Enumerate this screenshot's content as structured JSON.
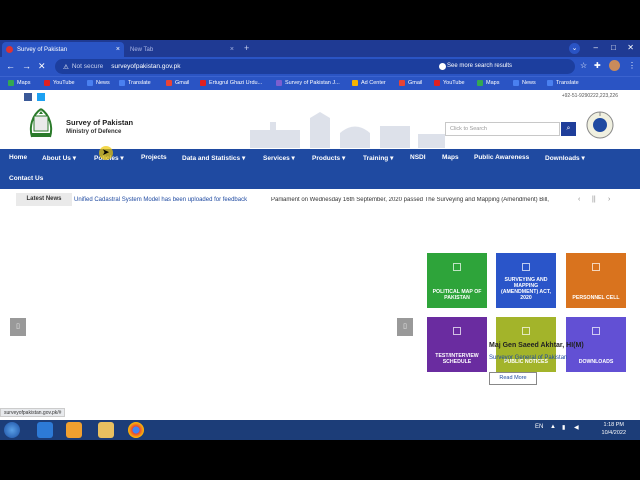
{
  "browser": {
    "active_tab": "Survey of Pakistan",
    "inactive_tab": "New Tab",
    "new_tab_symbol": "+",
    "close_symbol": "×",
    "security": "Not secure",
    "url": "surveyofpakistan.gov.pk",
    "search_hint": "See more search results",
    "bookmarks": [
      "Maps",
      "YouTube",
      "News",
      "Translate",
      "Gmail",
      "Ertugrul Ghazi Urdu...",
      "Survey of Pakistan J...",
      "Ad Center",
      "Gmail",
      "YouTube",
      "Maps",
      "News",
      "Translate"
    ]
  },
  "site": {
    "phone": "+92-51-9290222,223,226",
    "name": "Survey of Pakistan",
    "ministry": "Ministry of Defence",
    "search_placeholder": "Click to Search",
    "nav": [
      "Home",
      "About Us",
      "Policies",
      "Projects",
      "Data and Statistics",
      "Services",
      "Products",
      "Training",
      "NSDI",
      "Maps",
      "Public Awareness",
      "Downloads",
      "Contact Us"
    ],
    "news_label": "Latest News",
    "news_item_1": "Unified Cadastral System Model has been uploaded for feedback",
    "news_item_2": "Parliament on Wednesday 16th September, 2020 passed The Surveying and Mapping (Amendment) Bill,",
    "tiles": [
      {
        "label": "Political Map of Pakistan",
        "color": "#2ea43a"
      },
      {
        "label": "Surveying and Mapping (Amendment) Act, 2020",
        "color": "#2a55c9"
      },
      {
        "label": "Personnel Cell",
        "color": "#d9731e"
      },
      {
        "label": "Test/Interview Schedule",
        "color": "#6a2ca0"
      },
      {
        "label": "Public Notices",
        "color": "#a3b42a"
      },
      {
        "label": "Downloads",
        "color": "#6250d4"
      }
    ],
    "dg_name": "Maj Gen Saeed Akhtar, HI(M)",
    "dg_title": "Surveyor General of Pakistan",
    "read_more": "Read More"
  },
  "status_url": "surveyofpakistan.gov.pk/#",
  "taskbar": {
    "lang": "EN",
    "time": "1:18 PM",
    "date": "10/4/2022"
  },
  "colors": {
    "nav_bg": "#1f4aa1",
    "chrome": "#2a54c4",
    "taskbar": "#1c3d78"
  }
}
